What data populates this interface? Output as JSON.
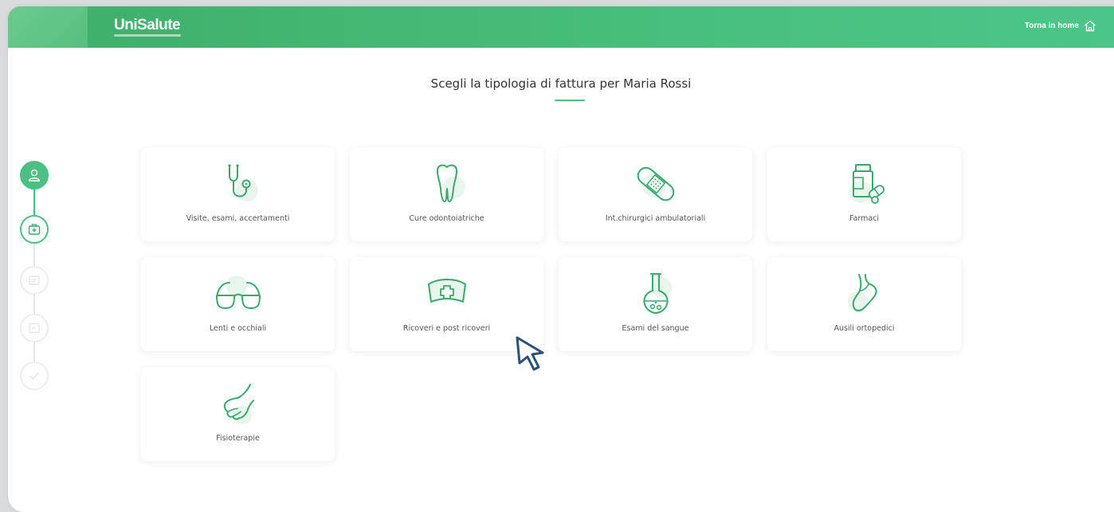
{
  "header": {
    "logo": "UniSalute",
    "home_label": "Torna in home"
  },
  "page": {
    "title": "Scegli la tipologia di fattura per Maria Rossi"
  },
  "stepper": {
    "steps": [
      {
        "icon": "user-icon",
        "state": "done"
      },
      {
        "icon": "medical-kit-icon",
        "state": "active"
      },
      {
        "icon": "invoice-icon",
        "state": "todo"
      },
      {
        "icon": "upload-document-icon",
        "state": "todo"
      },
      {
        "icon": "check-icon",
        "state": "todo"
      }
    ]
  },
  "cards": [
    {
      "label": "Visite, esami, accertamenti",
      "icon": "stethoscope-icon"
    },
    {
      "label": "Cure odontoiatriche",
      "icon": "tooth-icon"
    },
    {
      "label": "Int.chirurgici ambulatoriali",
      "icon": "bandage-icon"
    },
    {
      "label": "Farmaci",
      "icon": "medicine-bottle-icon"
    },
    {
      "label": "Lenti e occhiali",
      "icon": "glasses-icon"
    },
    {
      "label": "Ricoveri e post ricoveri",
      "icon": "nurse-cap-icon"
    },
    {
      "label": "Esami del sangue",
      "icon": "flask-icon"
    },
    {
      "label": "Ausili ortopedici",
      "icon": "foot-icon"
    },
    {
      "label": "Fisioterapie",
      "icon": "hand-icon"
    }
  ],
  "colors": {
    "brand": "#4cbf82",
    "icon_stroke": "#3aa96b",
    "icon_blob": "#e8f5ed"
  }
}
